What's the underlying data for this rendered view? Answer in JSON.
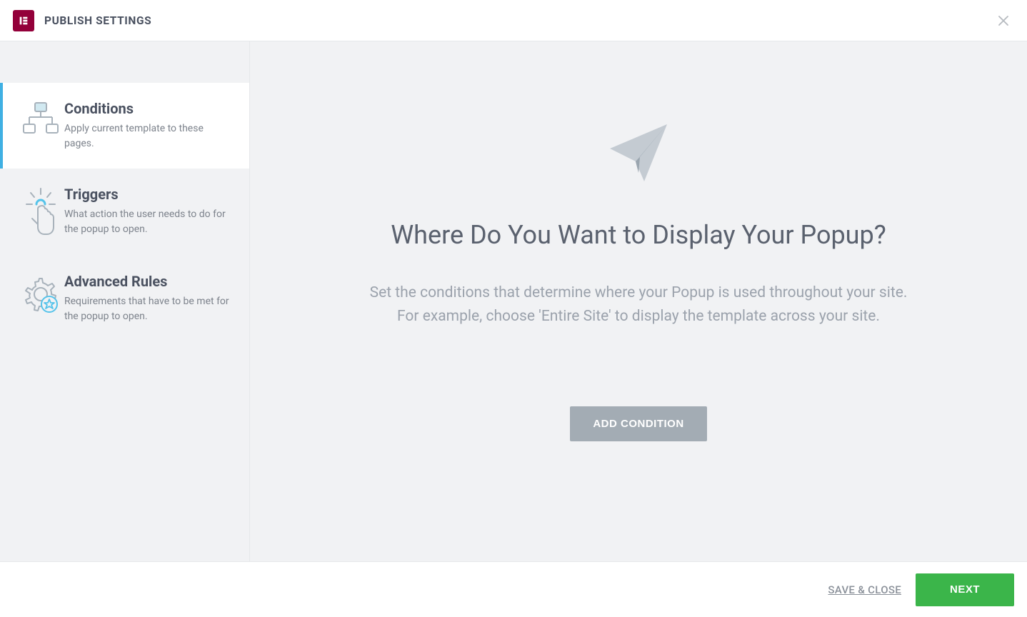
{
  "header": {
    "title": "PUBLISH SETTINGS"
  },
  "sidebar": {
    "items": [
      {
        "title": "Conditions",
        "desc": "Apply current template to these pages."
      },
      {
        "title": "Triggers",
        "desc": "What action the user needs to do for the popup to open."
      },
      {
        "title": "Advanced Rules",
        "desc": "Requirements that have to be met for the popup to open."
      }
    ]
  },
  "main": {
    "title": "Where Do You Want to Display Your Popup?",
    "desc_line1": "Set the conditions that determine where your Popup is used throughout your site.",
    "desc_line2": "For example, choose 'Entire Site' to display the template across your site.",
    "add_button_label": "ADD CONDITION"
  },
  "footer": {
    "save_close_label": "SAVE & CLOSE",
    "next_label": "NEXT"
  }
}
